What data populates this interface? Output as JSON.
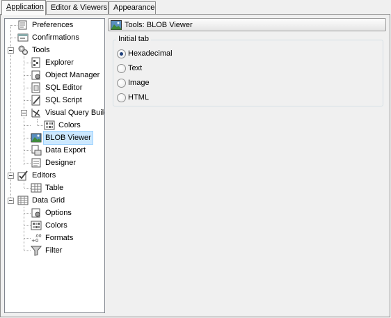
{
  "tabs": [
    {
      "label": "Application",
      "active": true
    },
    {
      "label": "Editor & Viewers",
      "active": false
    },
    {
      "label": "Appearance",
      "active": false
    }
  ],
  "tree": {
    "preferences": "Preferences",
    "confirmations": "Confirmations",
    "tools": "Tools",
    "explorer": "Explorer",
    "object_manager": "Object Manager",
    "sql_editor": "SQL Editor",
    "sql_script": "SQL Script",
    "visual_query_builder": "Visual Query Build",
    "colors": "Colors",
    "blob_viewer": "BLOB Viewer",
    "data_export": "Data Export",
    "designer": "Designer",
    "editors": "Editors",
    "table": "Table",
    "data_grid": "Data Grid",
    "options": "Options",
    "grid_colors": "Colors",
    "formats": "Formats",
    "filter": "Filter"
  },
  "panel": {
    "title": "Tools: BLOB Viewer",
    "group_title": "Initial tab",
    "options": [
      {
        "label": "Hexadecimal",
        "checked": true
      },
      {
        "label": "Text",
        "checked": false
      },
      {
        "label": "Image",
        "checked": false
      },
      {
        "label": "HTML",
        "checked": false
      }
    ]
  },
  "colors": {
    "selection_bg": "#cce8ff",
    "window_bg": "#f0f0f0"
  }
}
